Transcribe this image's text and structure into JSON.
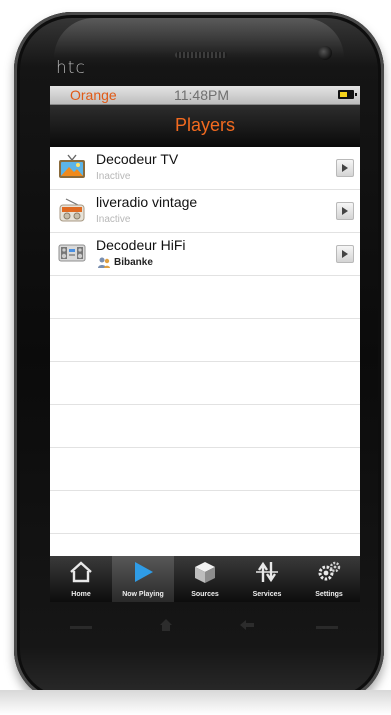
{
  "device": {
    "brand": "htc"
  },
  "status_bar": {
    "carrier": "Orange",
    "time": "11:48PM"
  },
  "header": {
    "title": "Players"
  },
  "players": [
    {
      "name": "Decodeur TV",
      "status": "Inactive",
      "icon": "tv-icon"
    },
    {
      "name": "liveradio vintage",
      "status": "Inactive",
      "icon": "radio-icon"
    },
    {
      "name": "Decodeur HiFi",
      "status": "Bibanke",
      "icon": "hifi-icon",
      "status_icon": "users-icon"
    }
  ],
  "tabs": [
    {
      "label": "Home",
      "icon": "home-icon"
    },
    {
      "label": "Now Playing",
      "icon": "play-icon",
      "active": true
    },
    {
      "label": "Sources",
      "icon": "cube-icon"
    },
    {
      "label": "Services",
      "icon": "arrows-icon"
    },
    {
      "label": "Settings",
      "icon": "gear-icon"
    }
  ],
  "colors": {
    "accent": "#f26a1f",
    "active_tab_icon": "#2f9ce6"
  }
}
